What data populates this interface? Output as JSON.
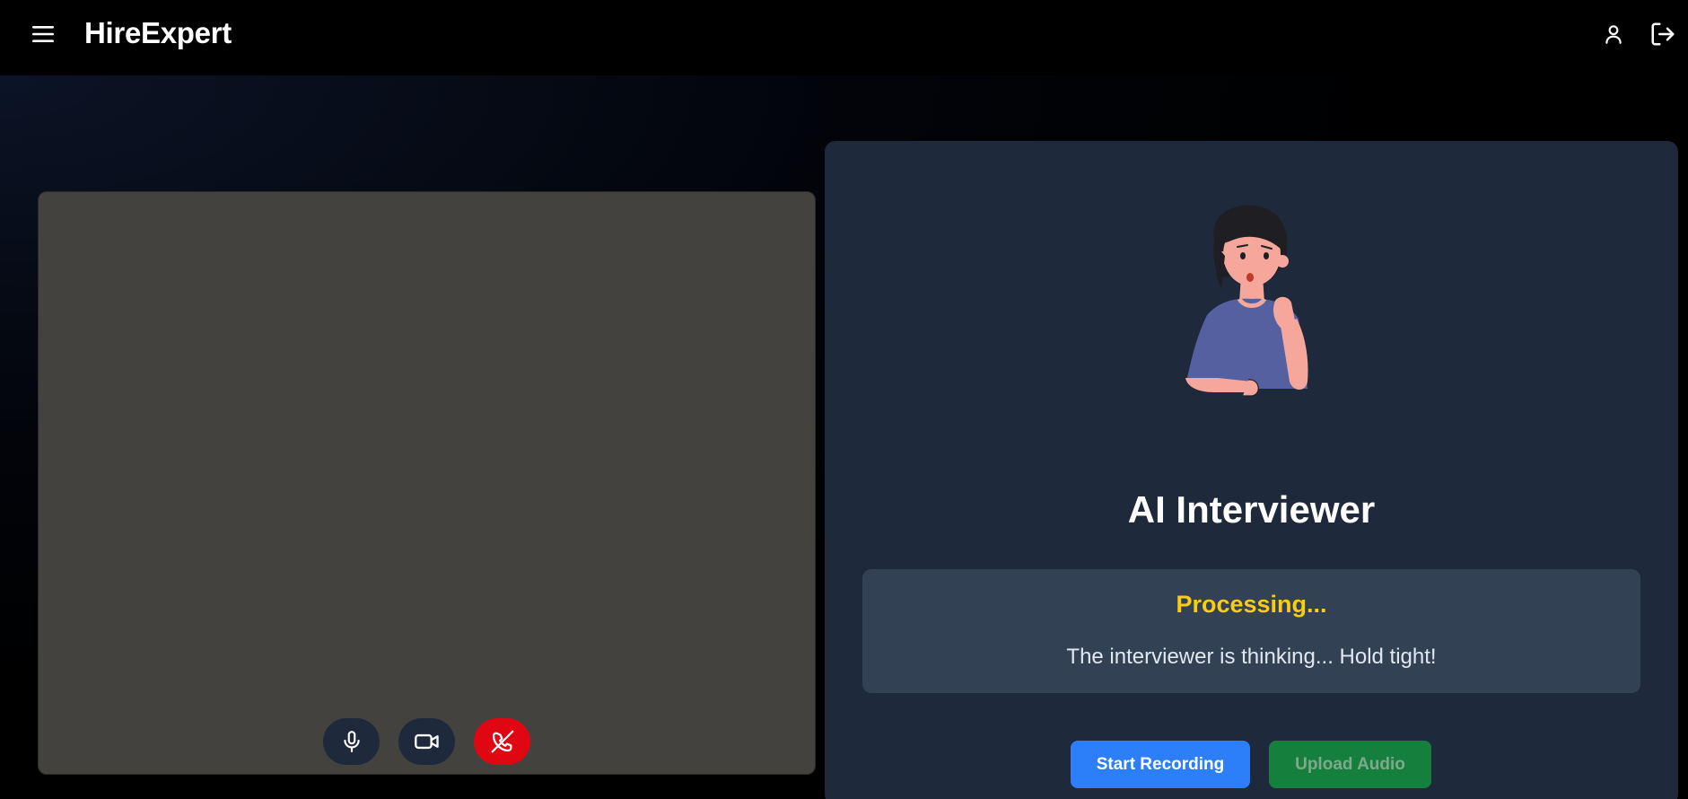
{
  "app": {
    "brand": "HireExpert"
  },
  "header": {
    "menu_icon": "hamburger-menu-icon",
    "user_icon": "user-icon",
    "logout_icon": "logout-icon"
  },
  "video": {
    "controls": [
      {
        "name": "microphone",
        "icon": "microphone-icon"
      },
      {
        "name": "camera",
        "icon": "video-camera-icon"
      },
      {
        "name": "end-call",
        "icon": "phone-off-icon"
      }
    ]
  },
  "interviewer": {
    "title": "AI Interviewer",
    "avatar": "thinking-woman-illustration",
    "status": {
      "title": "Processing...",
      "message": "The interviewer is thinking... Hold tight!"
    },
    "actions": {
      "start_recording": "Start Recording",
      "upload_audio": "Upload Audio"
    }
  },
  "colors": {
    "accent_blue": "#2d7ff9",
    "upload_green": "#15803d",
    "status_yellow": "#facc15",
    "end_call_red": "#e00712",
    "panel": "#1e293b"
  }
}
